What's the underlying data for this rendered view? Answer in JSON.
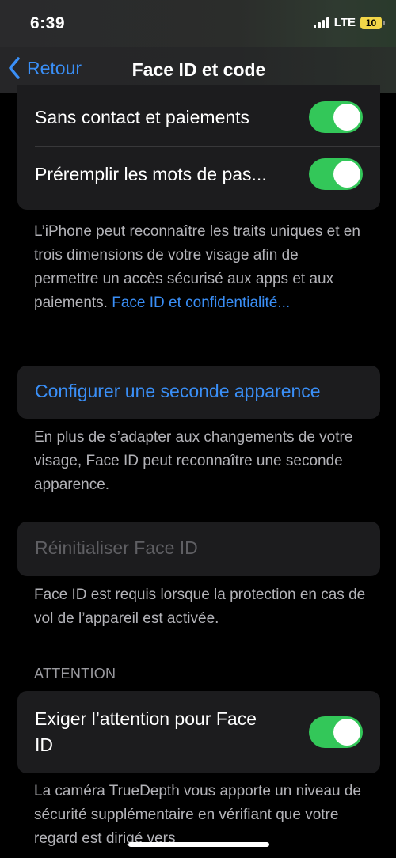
{
  "status_bar": {
    "time": "6:39",
    "network": "LTE",
    "battery": "10"
  },
  "nav": {
    "back_label": "Retour",
    "title": "Face ID et code"
  },
  "toggles_group": {
    "items": [
      {
        "label": "Sans contact et paiements",
        "on": true
      },
      {
        "label": "Préremplir les mots de pas...",
        "on": true
      }
    ]
  },
  "face_id_info": {
    "text": "L’iPhone peut reconnaître les traits uniques et en trois dimensions de votre visage afin de permettre un accès sécurisé aux apps et aux paiements.",
    "link": "Face ID et confidentialité..."
  },
  "alternate": {
    "label": "Configurer une seconde apparence",
    "footer": "En plus de s’adapter aux changements de votre visage, Face ID peut reconnaître une seconde apparence."
  },
  "reset": {
    "label": "Réinitialiser Face ID",
    "footer": "Face ID est requis lorsque la protection en cas de vol de l’appareil est activée."
  },
  "attention": {
    "header": "ATTENTION",
    "label": "Exiger l’attention pour Face ID",
    "on": true,
    "footer": "La caméra TrueDepth vous apporte un niveau de sécurité supplémentaire en vérifiant que votre regard est dirigé vers"
  },
  "colors": {
    "accent": "#3a8ff7",
    "toggle_on": "#33c759",
    "cell_bg": "#1c1c1e"
  }
}
